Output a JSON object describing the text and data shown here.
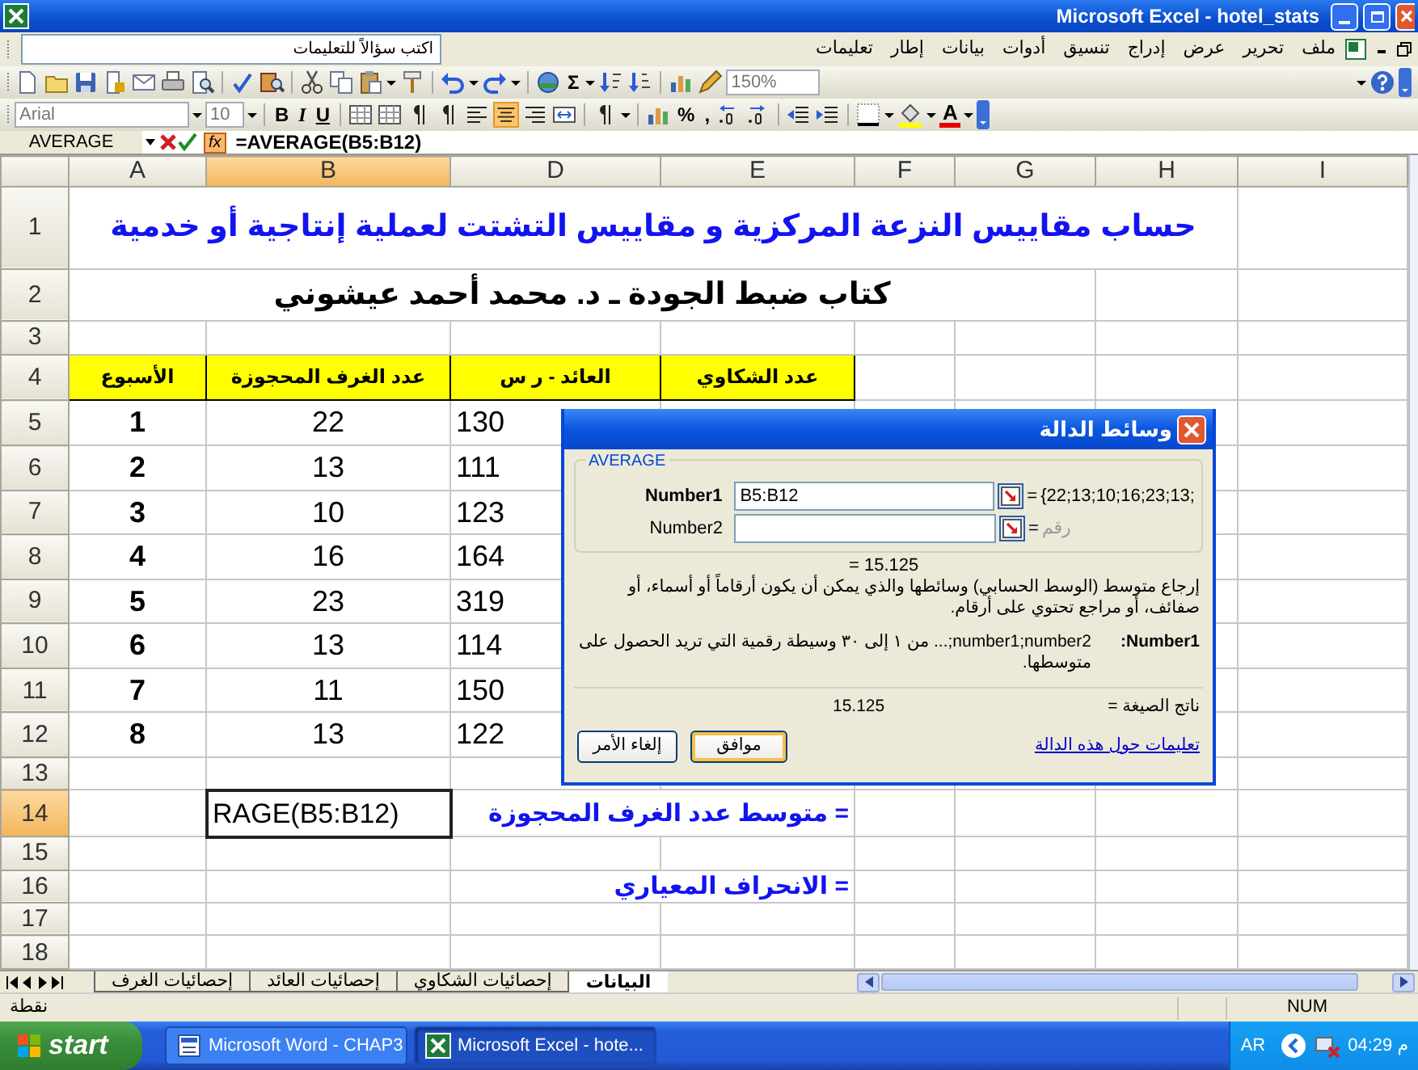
{
  "window": {
    "title": "Microsoft Excel - hotel_stats"
  },
  "help_box": {
    "placeholder": "اكتب سؤالاً للتعليمات"
  },
  "menu": [
    "ملف",
    "تحرير",
    "عرض",
    "إدراج",
    "تنسيق",
    "أدوات",
    "بيانات",
    "إطار",
    "تعليمات"
  ],
  "standard_toolbar": {
    "autosum": "Σ",
    "zoom": "150%"
  },
  "formatting_toolbar": {
    "font": "Arial",
    "size": "10",
    "bold": "B",
    "italic": "I",
    "underline": "U",
    "alignment": [
      {
        "selected": false
      },
      {
        "selected": true
      },
      {
        "selected": false
      }
    ],
    "percent": "%",
    "comma": ",",
    "font_color": "A"
  },
  "formula_bar": {
    "name_box": "AVERAGE",
    "fx": "fx",
    "formula": "=AVERAGE(B5:B12)"
  },
  "sheet": {
    "columns": [
      {
        "label": "I",
        "selected": false
      },
      {
        "label": "H",
        "selected": false
      },
      {
        "label": "G",
        "selected": false
      },
      {
        "label": "F",
        "selected": false
      },
      {
        "label": "E",
        "selected": false
      },
      {
        "label": "D",
        "selected": false
      },
      {
        "label": "B",
        "selected": true
      },
      {
        "label": "A",
        "selected": false
      }
    ],
    "rows": [
      {
        "number": "1",
        "selected": false,
        "kind": "title",
        "text": "حساب مقاييس النزعة المركزية و مقاييس التشتت لعملية إنتاجية أو خدمية"
      },
      {
        "number": "2",
        "selected": false,
        "kind": "subtitle",
        "text": "كتاب ضبط الجودة ـ د. محمد أحمد عيشوني"
      },
      {
        "number": "3",
        "selected": false,
        "kind": "blank"
      },
      {
        "number": "4",
        "selected": false,
        "kind": "header",
        "cells": [
          "عدد الشكاوي",
          "العائد - ر س",
          "عدد الغرف المحجوزة",
          "الأسبوع"
        ]
      },
      {
        "number": "5",
        "selected": false,
        "kind": "data",
        "marked": true,
        "cells": [
          "130",
          "22",
          "1"
        ]
      },
      {
        "number": "6",
        "selected": false,
        "kind": "data",
        "marked": true,
        "cells": [
          "111",
          "13",
          "2"
        ]
      },
      {
        "number": "7",
        "selected": false,
        "kind": "data",
        "marked": true,
        "cells": [
          "123",
          "10",
          "3"
        ]
      },
      {
        "number": "8",
        "selected": false,
        "kind": "data",
        "marked": true,
        "cells": [
          "164",
          "16",
          "4"
        ]
      },
      {
        "number": "9",
        "selected": false,
        "kind": "data",
        "marked": true,
        "cells": [
          "319",
          "23",
          "5"
        ]
      },
      {
        "number": "10",
        "selected": false,
        "kind": "data",
        "marked": true,
        "cells": [
          "114",
          "13",
          "6"
        ]
      },
      {
        "number": "11",
        "selected": false,
        "kind": "data",
        "marked": true,
        "cells": [
          "150",
          "11",
          "7"
        ]
      },
      {
        "number": "12",
        "selected": false,
        "kind": "data",
        "marked": true,
        "cells": [
          "122",
          "13",
          "8"
        ]
      },
      {
        "number": "13",
        "selected": false,
        "kind": "blank"
      },
      {
        "number": "14",
        "selected": true,
        "kind": "formula",
        "value": "RAGE(B5:B12)",
        "label": "متوسط عدد الغرف المحجوزة ="
      },
      {
        "number": "15",
        "selected": false,
        "kind": "blank"
      },
      {
        "number": "16",
        "selected": false,
        "kind": "note",
        "label": "الانحراف المعياري ="
      },
      {
        "number": "17",
        "selected": false,
        "kind": "blank"
      },
      {
        "number": "18",
        "selected": false,
        "kind": "blank"
      }
    ]
  },
  "dialog": {
    "title": "وسائط الدالة",
    "function": "AVERAGE",
    "arguments": [
      {
        "label": "Number1",
        "value": "B5:B12",
        "active": true,
        "equals": "=",
        "result": "{22;13;10;16;23;13;",
        "hint": false
      },
      {
        "label": "Number2",
        "active": false,
        "equals": "=",
        "result": "رقم",
        "hint": true
      }
    ],
    "preview": "= 15.125",
    "description": "إرجاع متوسط (الوسط الحسابي) وسائطها والذي يمكن أن يكون أرقاماً أو أسماء، أو صفائف، أو مراجع تحتوي على أرقام.",
    "argument_help": {
      "label": "Number1:",
      "text": "number1;number2;... من ١ إلى ٣٠ وسيطة رقمية التي تريد الحصول على متوسطها."
    },
    "formula_result": {
      "label": "ناتج الصيغة =",
      "value": "15.125"
    },
    "help_link": "تعليمات حول هذه الدالة",
    "buttons": [
      {
        "label": "موافق",
        "default": true
      },
      {
        "label": "إلغاء الأمر",
        "default": false
      }
    ]
  },
  "sheet_tabs": [
    {
      "label": "البيانات",
      "selected": true
    },
    {
      "label": "إحصائيات الشكاوي",
      "selected": false
    },
    {
      "label": "إحصائيات العائد",
      "selected": false
    },
    {
      "label": "إحصائيات الغرف",
      "selected": false
    }
  ],
  "status_bar": {
    "mode": "نقطة",
    "num": "NUM"
  },
  "taskbar": {
    "start": "start",
    "tasks": [
      {
        "label": "Microsoft Excel - hote...",
        "kind": "spreadsheet",
        "selected": true
      },
      {
        "label": "Microsoft Word - CHAP3",
        "kind": "document",
        "selected": false
      }
    ],
    "language": "AR",
    "clock": "04:29 م"
  }
}
